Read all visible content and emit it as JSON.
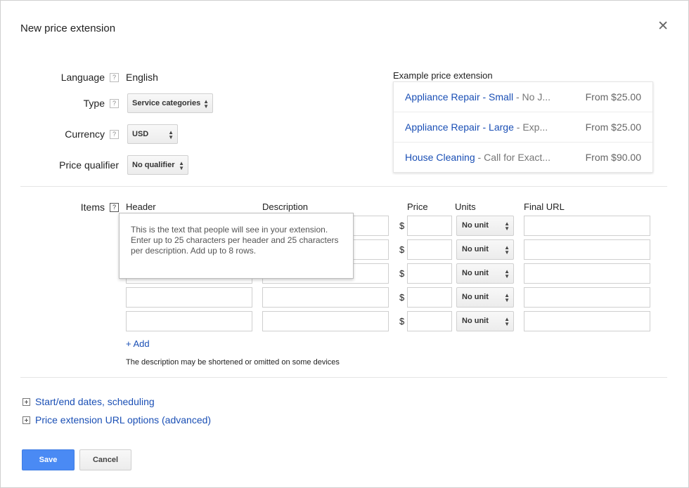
{
  "dialog": {
    "title": "New price extension",
    "close_icon": "close-icon",
    "help_glyph": "?"
  },
  "form": {
    "language": {
      "label": "Language",
      "value": "English"
    },
    "type": {
      "label": "Type",
      "value": "Service categories"
    },
    "currency": {
      "label": "Currency",
      "value": "USD"
    },
    "qualifier": {
      "label": "Price qualifier",
      "value": "No qualifier"
    }
  },
  "example": {
    "title": "Example price extension",
    "rows": [
      {
        "header": "Appliance Repair - Small",
        "dash": " - ",
        "desc": "No J...",
        "price": "From $25.00"
      },
      {
        "header": "Appliance Repair - Large",
        "dash": " - ",
        "desc": "Exp...",
        "price": "From $25.00"
      },
      {
        "header": "House Cleaning",
        "dash": " - ",
        "desc": "Call for Exact...",
        "price": "From $90.00"
      }
    ]
  },
  "items": {
    "label": "Items",
    "columns": {
      "header": "Header",
      "description": "Description",
      "price": "Price",
      "units": "Units",
      "final_url": "Final URL"
    },
    "currency_symbol": "$",
    "unit_value": "No unit",
    "row_count": 5,
    "tooltip": "This is the text that people will see in your extension. Enter up to 25 characters per header and 25 characters per description. Add up to 8 rows.",
    "add_label": "+ Add",
    "note": "The description may be shortened or omitted on some devices"
  },
  "sections": {
    "scheduling": "Start/end dates, scheduling",
    "url_options": "Price extension URL options (advanced)"
  },
  "buttons": {
    "save": "Save",
    "cancel": "Cancel"
  },
  "colors": {
    "link": "#1a4fb5",
    "primary_button": "#4a8af4"
  }
}
